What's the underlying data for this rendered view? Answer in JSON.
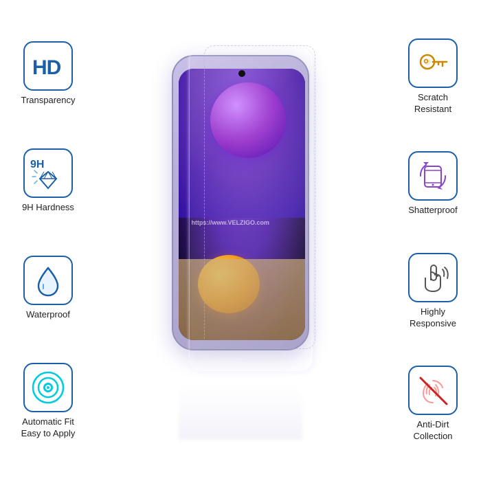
{
  "features_left": [
    {
      "id": "hd-transparency",
      "icon": "hd",
      "label": "Transparency"
    },
    {
      "id": "9h-hardness",
      "icon": "diamond",
      "label": "9H Hardness"
    },
    {
      "id": "waterproof",
      "icon": "drop",
      "label": "Waterproof"
    },
    {
      "id": "auto-fit",
      "icon": "target",
      "label": "Automatic Fit\nEasy to Apply"
    }
  ],
  "features_right": [
    {
      "id": "scratch-resistant",
      "icon": "key",
      "label": "Scratch\nResistant"
    },
    {
      "id": "shatterproof",
      "icon": "rotate",
      "label": "Shatterproof"
    },
    {
      "id": "highly-responsive",
      "icon": "touch",
      "label": "Highly\nResponsive"
    },
    {
      "id": "anti-dirt",
      "icon": "fingerprint",
      "label": "Anti-Dirt\nCollection"
    }
  ],
  "watermark": "https://www.VELZIGO.com",
  "brand": "VELZIGO"
}
